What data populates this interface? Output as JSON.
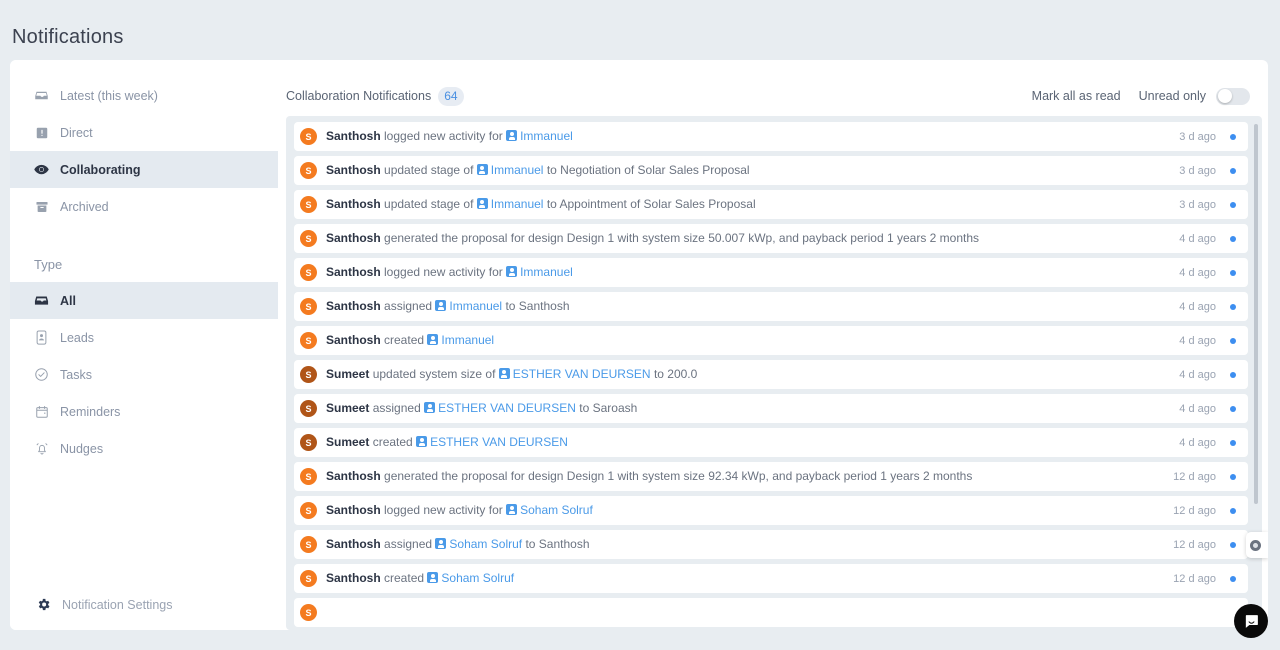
{
  "page": {
    "title": "Notifications"
  },
  "sidebar": {
    "primary_items": [
      {
        "label": "Latest (this week)",
        "icon": "inbox-icon",
        "active": false
      },
      {
        "label": "Direct",
        "icon": "alert-icon",
        "active": false
      },
      {
        "label": "Collaborating",
        "icon": "eye-icon",
        "active": true
      },
      {
        "label": "Archived",
        "icon": "archive-icon",
        "active": false
      }
    ],
    "type_section_label": "Type",
    "type_items": [
      {
        "label": "All",
        "icon": "inbox-icon",
        "active": true
      },
      {
        "label": "Leads",
        "icon": "lead-icon",
        "active": false
      },
      {
        "label": "Tasks",
        "icon": "check-circle-icon",
        "active": false
      },
      {
        "label": "Reminders",
        "icon": "calendar-icon",
        "active": false
      },
      {
        "label": "Nudges",
        "icon": "bell-icon",
        "active": false
      }
    ],
    "settings_label": "Notification Settings",
    "settings_icon": "gear-icon"
  },
  "header": {
    "title": "Collaboration Notifications",
    "count": "64",
    "mark_all_as_read": "Mark all as read",
    "unread_only_label": "Unread only",
    "unread_only_on": false
  },
  "colors": {
    "accent_blue": "#4a9ae8",
    "unread_dot": "#3d8ef0",
    "avatar_orange": "#f47b20",
    "avatar_brown": "#b05518",
    "badge_bg": "#e7ecf3",
    "page_bg": "#e8edf1"
  },
  "notifications": [
    {
      "avatar_initial": "S",
      "avatar_color": "#f47b20",
      "actor": "Santhosh",
      "action_before": "logged new activity for",
      "link": "Immanuel",
      "has_lead_icon": true,
      "action_after": "",
      "time": "3 d ago",
      "unread": true
    },
    {
      "avatar_initial": "S",
      "avatar_color": "#f47b20",
      "actor": "Santhosh",
      "action_before": "updated stage of",
      "link": "Immanuel",
      "has_lead_icon": true,
      "action_after": "to Negotiation of Solar Sales Proposal",
      "time": "3 d ago",
      "unread": true
    },
    {
      "avatar_initial": "S",
      "avatar_color": "#f47b20",
      "actor": "Santhosh",
      "action_before": "updated stage of",
      "link": "Immanuel",
      "has_lead_icon": true,
      "action_after": "to Appointment of Solar Sales Proposal",
      "time": "3 d ago",
      "unread": true
    },
    {
      "avatar_initial": "S",
      "avatar_color": "#f47b20",
      "actor": "Santhosh",
      "action_before": "generated the proposal for design Design 1 with system size 50.007 kWp, and payback period 1 years 2 months",
      "link": "",
      "has_lead_icon": false,
      "action_after": "",
      "time": "4 d ago",
      "unread": true
    },
    {
      "avatar_initial": "S",
      "avatar_color": "#f47b20",
      "actor": "Santhosh",
      "action_before": "logged new activity for",
      "link": "Immanuel",
      "has_lead_icon": true,
      "action_after": "",
      "time": "4 d ago",
      "unread": true
    },
    {
      "avatar_initial": "S",
      "avatar_color": "#f47b20",
      "actor": "Santhosh",
      "action_before": "assigned",
      "link": "Immanuel",
      "has_lead_icon": true,
      "action_after": "to Santhosh",
      "time": "4 d ago",
      "unread": true
    },
    {
      "avatar_initial": "S",
      "avatar_color": "#f47b20",
      "actor": "Santhosh",
      "action_before": "created",
      "link": "Immanuel",
      "has_lead_icon": true,
      "action_after": "",
      "time": "4 d ago",
      "unread": true
    },
    {
      "avatar_initial": "S",
      "avatar_color": "#b05518",
      "actor": "Sumeet",
      "action_before": "updated system size of",
      "link": "ESTHER VAN DEURSEN",
      "has_lead_icon": true,
      "action_after": "to 200.0",
      "time": "4 d ago",
      "unread": true
    },
    {
      "avatar_initial": "S",
      "avatar_color": "#b05518",
      "actor": "Sumeet",
      "action_before": "assigned",
      "link": "ESTHER VAN DEURSEN",
      "has_lead_icon": true,
      "action_after": "to Saroash",
      "time": "4 d ago",
      "unread": true
    },
    {
      "avatar_initial": "S",
      "avatar_color": "#b05518",
      "actor": "Sumeet",
      "action_before": "created",
      "link": "ESTHER VAN DEURSEN",
      "has_lead_icon": true,
      "action_after": "",
      "time": "4 d ago",
      "unread": true
    },
    {
      "avatar_initial": "S",
      "avatar_color": "#f47b20",
      "actor": "Santhosh",
      "action_before": "generated the proposal for design Design 1 with system size 92.34 kWp, and payback period 1 years 2 months",
      "link": "",
      "has_lead_icon": false,
      "action_after": "",
      "time": "12 d ago",
      "unread": true
    },
    {
      "avatar_initial": "S",
      "avatar_color": "#f47b20",
      "actor": "Santhosh",
      "action_before": "logged new activity for",
      "link": "Soham Solruf",
      "has_lead_icon": true,
      "action_after": "",
      "time": "12 d ago",
      "unread": true
    },
    {
      "avatar_initial": "S",
      "avatar_color": "#f47b20",
      "actor": "Santhosh",
      "action_before": "assigned",
      "link": "Soham Solruf",
      "has_lead_icon": true,
      "action_after": "to Santhosh",
      "time": "12 d ago",
      "unread": true
    },
    {
      "avatar_initial": "S",
      "avatar_color": "#f47b20",
      "actor": "Santhosh",
      "action_before": "created",
      "link": "Soham Solruf",
      "has_lead_icon": true,
      "action_after": "",
      "time": "12 d ago",
      "unread": true
    },
    {
      "avatar_initial": "S",
      "avatar_color": "#f47b20",
      "actor": "",
      "action_before": "",
      "link": "",
      "has_lead_icon": false,
      "action_after": "",
      "time": "",
      "unread": false
    }
  ],
  "widgets": {
    "side_tab_icon": "circle-ring-icon",
    "chat_icon": "chat-bubble-icon"
  }
}
